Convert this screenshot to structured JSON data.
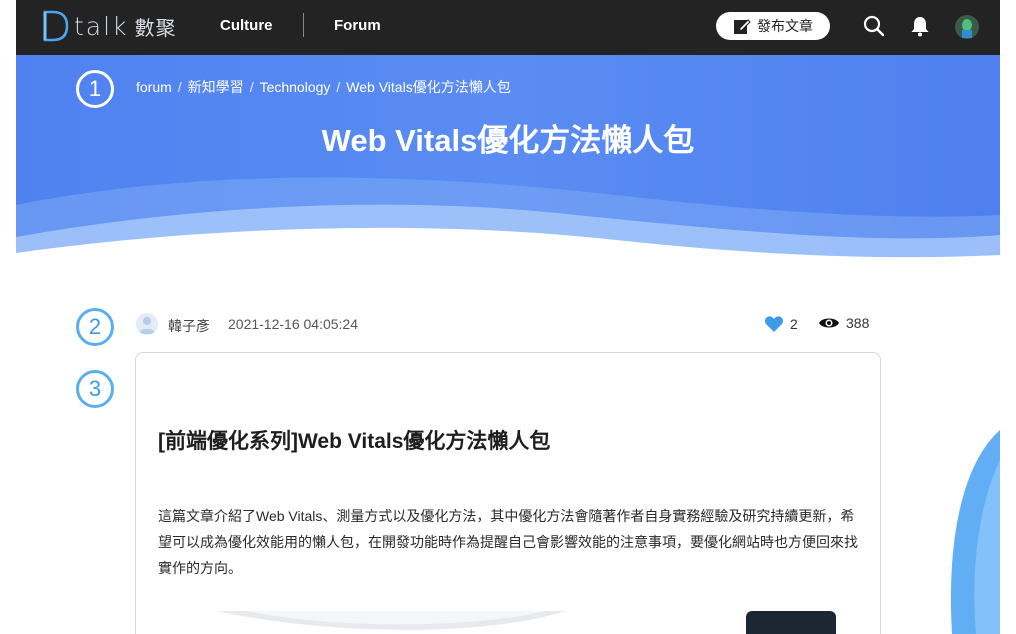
{
  "nav": {
    "logo_word": "talk",
    "logo_cn": "數聚",
    "links": [
      "Culture",
      "Forum"
    ],
    "post_button": "發布文章",
    "icons": [
      "search-icon",
      "bell-icon",
      "user-avatar"
    ]
  },
  "hero": {
    "breadcrumb": [
      "forum",
      "新知學習",
      "Technology",
      "Web Vitals優化方法懶人包"
    ],
    "title": "Web Vitals優化方法懶人包"
  },
  "steps": [
    "1",
    "2",
    "3"
  ],
  "post": {
    "author": "韓子彥",
    "date": "2021-12-16 04:05:24",
    "likes": "2",
    "views": "388"
  },
  "article": {
    "heading": "[前端優化系列]Web Vitals優化方法懶人包",
    "intro": "這篇文章介紹了Web Vitals、測量方式以及優化方法，其中優化方法會隨著作者自身實務經驗及研究持續更新，希望可以成為優化效能用的懶人包，在開發功能時作為提醒自己會影響效能的注意事項，要優化網站時也方便回來找實作的方向。"
  },
  "colors": {
    "nav_bg": "#232323",
    "hero_blue": "#5a8cf3",
    "accent_blue": "#3d9be9"
  }
}
